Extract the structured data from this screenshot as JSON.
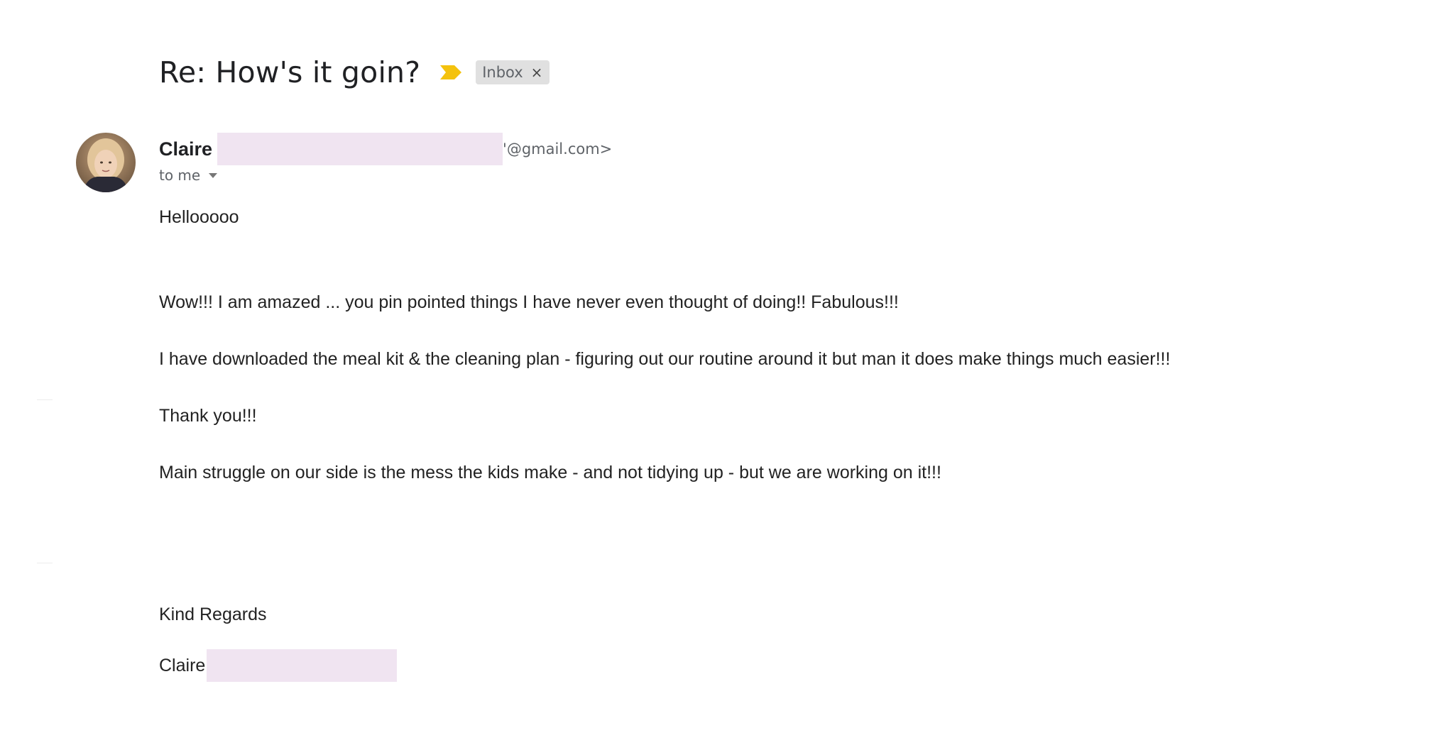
{
  "email": {
    "subject": "Re: How's it goin?",
    "label": "Inbox",
    "label_remove_glyph": "×",
    "importance_color": "#f4c20d",
    "sender": {
      "name": "Claire",
      "email_suffix": "'@gmail.com>"
    },
    "recipient_text": "to me",
    "body": [
      "Hellooooo",
      "Wow!!! I am amazed ... you pin pointed things I have never even thought of doing!! Fabulous!!!",
      "I have downloaded the meal kit & the cleaning plan - figuring out our routine around it but man it does make things much easier!!!",
      "Thank you!!!",
      "Main struggle on our side is the mess the kids make - and not tidying up - but we are working on it!!!"
    ],
    "closing": "Kind Regards",
    "signature_name": "Claire"
  },
  "colors": {
    "redaction": "#f0e4f1",
    "text": "#222222",
    "muted": "#5f6368"
  }
}
